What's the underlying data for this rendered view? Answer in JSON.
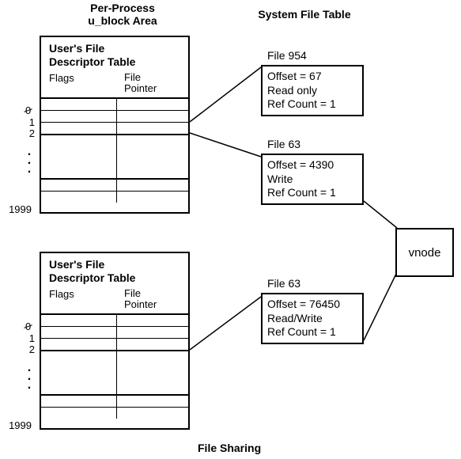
{
  "left_header_line1": "Per-Process",
  "left_header_line2": "u_block Area",
  "right_header": "System File Table",
  "fdt": {
    "title_line1": "User's File",
    "title_line2": "Descriptor Table",
    "col_flags": "Flags",
    "col_ptr_line1": "File",
    "col_ptr_line2": "Pointer",
    "rows": {
      "zero": "0",
      "one": "1",
      "two": "2",
      "last": "1999"
    }
  },
  "system_files": {
    "f0": {
      "label": "File 954",
      "offset": "Offset = 67",
      "mode": "Read only",
      "refcount": "Ref Count = 1"
    },
    "f1": {
      "label": "File 63",
      "offset": "Offset = 4390",
      "mode": "Write",
      "refcount": "Ref Count = 1"
    },
    "f2": {
      "label": "File 63",
      "offset": "Offset = 76450",
      "mode": "Read/Write",
      "refcount": "Ref Count = 1"
    }
  },
  "vnode_label": "vnode",
  "footer": "File Sharing",
  "chart_data": {
    "type": "table",
    "title": "File Sharing",
    "description": "Two per-process user file descriptor tables (u_block area) with entries pointing into a shared System File Table; multiple system-file-table entries for the same file share a single vnode.",
    "fd_table_index_range": [
      0,
      1999
    ],
    "fd_table_columns": [
      "Flags",
      "File Pointer"
    ],
    "system_file_table": [
      {
        "file": 954,
        "offset": 67,
        "mode": "Read only",
        "ref_count": 1,
        "pointed_from": "process A, fd 1"
      },
      {
        "file": 63,
        "offset": 4390,
        "mode": "Write",
        "ref_count": 1,
        "pointed_from": "process A, fd 2",
        "shares_vnode_with": "entry for File 63 offset 76450"
      },
      {
        "file": 63,
        "offset": 76450,
        "mode": "Read/Write",
        "ref_count": 1,
        "pointed_from": "process B, fd 2",
        "shares_vnode_with": "entry for File 63 offset 4390"
      }
    ],
    "vnode_shared_by_file": 63
  }
}
